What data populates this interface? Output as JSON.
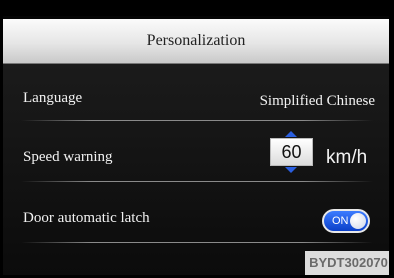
{
  "header": {
    "title": "Personalization"
  },
  "settings": {
    "language": {
      "label": "Language",
      "value": "Simplified Chinese"
    },
    "speed_warning": {
      "label": "Speed warning",
      "value": "60",
      "unit": "km/h"
    },
    "door_latch": {
      "label": "Door automatic latch",
      "toggle_label": "ON",
      "state": "on"
    }
  },
  "watermark": "BYDT302070",
  "colors": {
    "accent": "#2a5fe0",
    "toggle_on": "#1f5cf0",
    "background": "#0b0b0b"
  }
}
